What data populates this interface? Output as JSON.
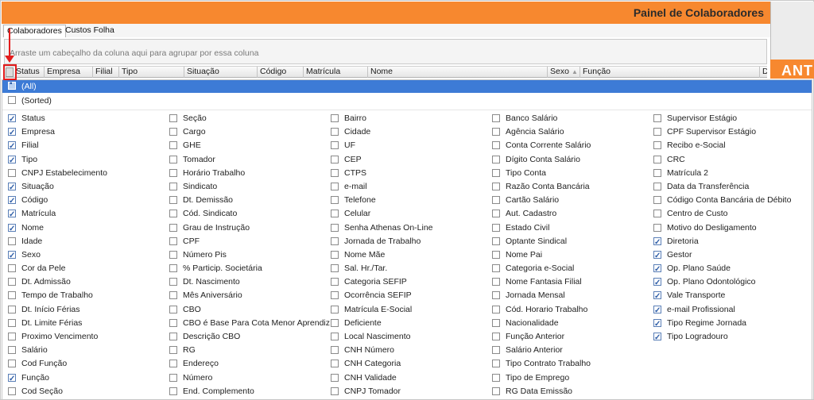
{
  "header": {
    "title": "Painel de Colaboradores",
    "side_text": "ANTE"
  },
  "tabs": [
    {
      "label": "Colaboradores",
      "active": true
    },
    {
      "label": "Custos Folha",
      "active": false
    }
  ],
  "group_panel": {
    "hint": "Arraste um cabeçalho da coluna aqui para agrupar por essa coluna"
  },
  "columns": {
    "status": "Status",
    "empresa": "Empresa",
    "filial": "Filial",
    "tipo": "Tipo",
    "situacao": "Situação",
    "codigo": "Código",
    "matricula": "Matrícula",
    "nome": "Nome",
    "sexo": "Sexo",
    "funcao": "Função",
    "di": "Di"
  },
  "accent_color": "#f7882f",
  "selection_color": "#3d7bd6",
  "highlight_color": "#e31c1c",
  "dropdown": {
    "all_label": "(All)",
    "sorted_label": "(Sorted)",
    "columns": [
      [
        {
          "label": "Status",
          "checked": true
        },
        {
          "label": "Empresa",
          "checked": true
        },
        {
          "label": "Filial",
          "checked": true
        },
        {
          "label": "Tipo",
          "checked": true
        },
        {
          "label": "CNPJ Estabelecimento",
          "checked": false
        },
        {
          "label": "Situação",
          "checked": true
        },
        {
          "label": "Código",
          "checked": true
        },
        {
          "label": "Matrícula",
          "checked": true
        },
        {
          "label": "Nome",
          "checked": true
        },
        {
          "label": "Idade",
          "checked": false
        },
        {
          "label": "Sexo",
          "checked": true
        },
        {
          "label": "Cor da Pele",
          "checked": false
        },
        {
          "label": "Dt. Admissão",
          "checked": false
        },
        {
          "label": "Tempo de Trabalho",
          "checked": false
        },
        {
          "label": "Dt. Início Férias",
          "checked": false
        },
        {
          "label": "Dt. Limite Férias",
          "checked": false
        },
        {
          "label": "Proximo Vencimento",
          "checked": false
        },
        {
          "label": "Salário",
          "checked": false
        },
        {
          "label": "Cod Função",
          "checked": false
        },
        {
          "label": "Função",
          "checked": true
        },
        {
          "label": "Cod Seção",
          "checked": false
        }
      ],
      [
        {
          "label": "Seção",
          "checked": false
        },
        {
          "label": "Cargo",
          "checked": false
        },
        {
          "label": "GHE",
          "checked": false
        },
        {
          "label": "Tomador",
          "checked": false
        },
        {
          "label": "Horário Trabalho",
          "checked": false
        },
        {
          "label": "Sindicato",
          "checked": false
        },
        {
          "label": "Dt. Demissão",
          "checked": false
        },
        {
          "label": "Cód. Sindicato",
          "checked": false
        },
        {
          "label": "Grau de Instrução",
          "checked": false
        },
        {
          "label": "CPF",
          "checked": false
        },
        {
          "label": "Número Pis",
          "checked": false
        },
        {
          "label": "% Particip. Societária",
          "checked": false
        },
        {
          "label": "Dt. Nascimento",
          "checked": false
        },
        {
          "label": "Mês Aniversário",
          "checked": false
        },
        {
          "label": "CBO",
          "checked": false
        },
        {
          "label": "CBO é Base Para Cota Menor Aprendiz ?",
          "checked": false
        },
        {
          "label": "Descrição CBO",
          "checked": false
        },
        {
          "label": "RG",
          "checked": false
        },
        {
          "label": "Endereço",
          "checked": false
        },
        {
          "label": "Número",
          "checked": false
        },
        {
          "label": "End. Complemento",
          "checked": false
        }
      ],
      [
        {
          "label": "Bairro",
          "checked": false
        },
        {
          "label": "Cidade",
          "checked": false
        },
        {
          "label": "UF",
          "checked": false
        },
        {
          "label": "CEP",
          "checked": false
        },
        {
          "label": "CTPS",
          "checked": false
        },
        {
          "label": "e-mail",
          "checked": false
        },
        {
          "label": "Telefone",
          "checked": false
        },
        {
          "label": "Celular",
          "checked": false
        },
        {
          "label": "Senha Athenas On-Line",
          "checked": false
        },
        {
          "label": "Jornada de Trabalho",
          "checked": false
        },
        {
          "label": "Nome Mãe",
          "checked": false
        },
        {
          "label": "Sal. Hr./Tar.",
          "checked": false
        },
        {
          "label": "Categoria SEFIP",
          "checked": false
        },
        {
          "label": "Ocorrência SEFIP",
          "checked": false
        },
        {
          "label": "Matrícula E-Social",
          "checked": false
        },
        {
          "label": "Deficiente",
          "checked": false
        },
        {
          "label": "Local Nascimento",
          "checked": false
        },
        {
          "label": "CNH Número",
          "checked": false
        },
        {
          "label": "CNH Categoria",
          "checked": false
        },
        {
          "label": "CNH Validade",
          "checked": false
        },
        {
          "label": "CNPJ Tomador",
          "checked": false
        }
      ],
      [
        {
          "label": "Banco Salário",
          "checked": false
        },
        {
          "label": "Agência Salário",
          "checked": false
        },
        {
          "label": "Conta Corrente Salário",
          "checked": false
        },
        {
          "label": "Dígito Conta Salário",
          "checked": false
        },
        {
          "label": "Tipo Conta",
          "checked": false
        },
        {
          "label": "Razão Conta Bancária",
          "checked": false
        },
        {
          "label": "Cartão Salário",
          "checked": false
        },
        {
          "label": "Aut. Cadastro",
          "checked": false
        },
        {
          "label": "Estado Civil",
          "checked": false
        },
        {
          "label": "Optante Sindical",
          "checked": false
        },
        {
          "label": "Nome Pai",
          "checked": false
        },
        {
          "label": "Categoria e-Social",
          "checked": false
        },
        {
          "label": "Nome Fantasia Filial",
          "checked": false
        },
        {
          "label": "Jornada Mensal",
          "checked": false
        },
        {
          "label": "Cód. Horario Trabalho",
          "checked": false
        },
        {
          "label": "Nacionalidade",
          "checked": false
        },
        {
          "label": "Função Anterior",
          "checked": false
        },
        {
          "label": "Salário Anterior",
          "checked": false
        },
        {
          "label": "Tipo Contrato Trabalho",
          "checked": false
        },
        {
          "label": "Tipo de Emprego",
          "checked": false
        },
        {
          "label": "RG Data Emissão",
          "checked": false
        }
      ],
      [
        {
          "label": "Supervisor Estágio",
          "checked": false
        },
        {
          "label": "CPF Supervisor Estágio",
          "checked": false
        },
        {
          "label": "Recibo e-Social",
          "checked": false
        },
        {
          "label": "CRC",
          "checked": false
        },
        {
          "label": "Matrícula 2",
          "checked": false
        },
        {
          "label": "Data da Transferência",
          "checked": false
        },
        {
          "label": "Código Conta Bancária de Débito",
          "checked": false
        },
        {
          "label": "Centro de Custo",
          "checked": false
        },
        {
          "label": "Motivo do Desligamento",
          "checked": false
        },
        {
          "label": "Diretoria",
          "checked": true
        },
        {
          "label": "Gestor",
          "checked": true
        },
        {
          "label": "Op. Plano Saúde",
          "checked": true
        },
        {
          "label": "Op. Plano Odontológico",
          "checked": true
        },
        {
          "label": "Vale Transporte",
          "checked": true
        },
        {
          "label": "e-mail Profissional",
          "checked": true
        },
        {
          "label": "Tipo Regime Jornada",
          "checked": true
        },
        {
          "label": "Tipo Logradouro",
          "checked": true
        }
      ]
    ]
  }
}
